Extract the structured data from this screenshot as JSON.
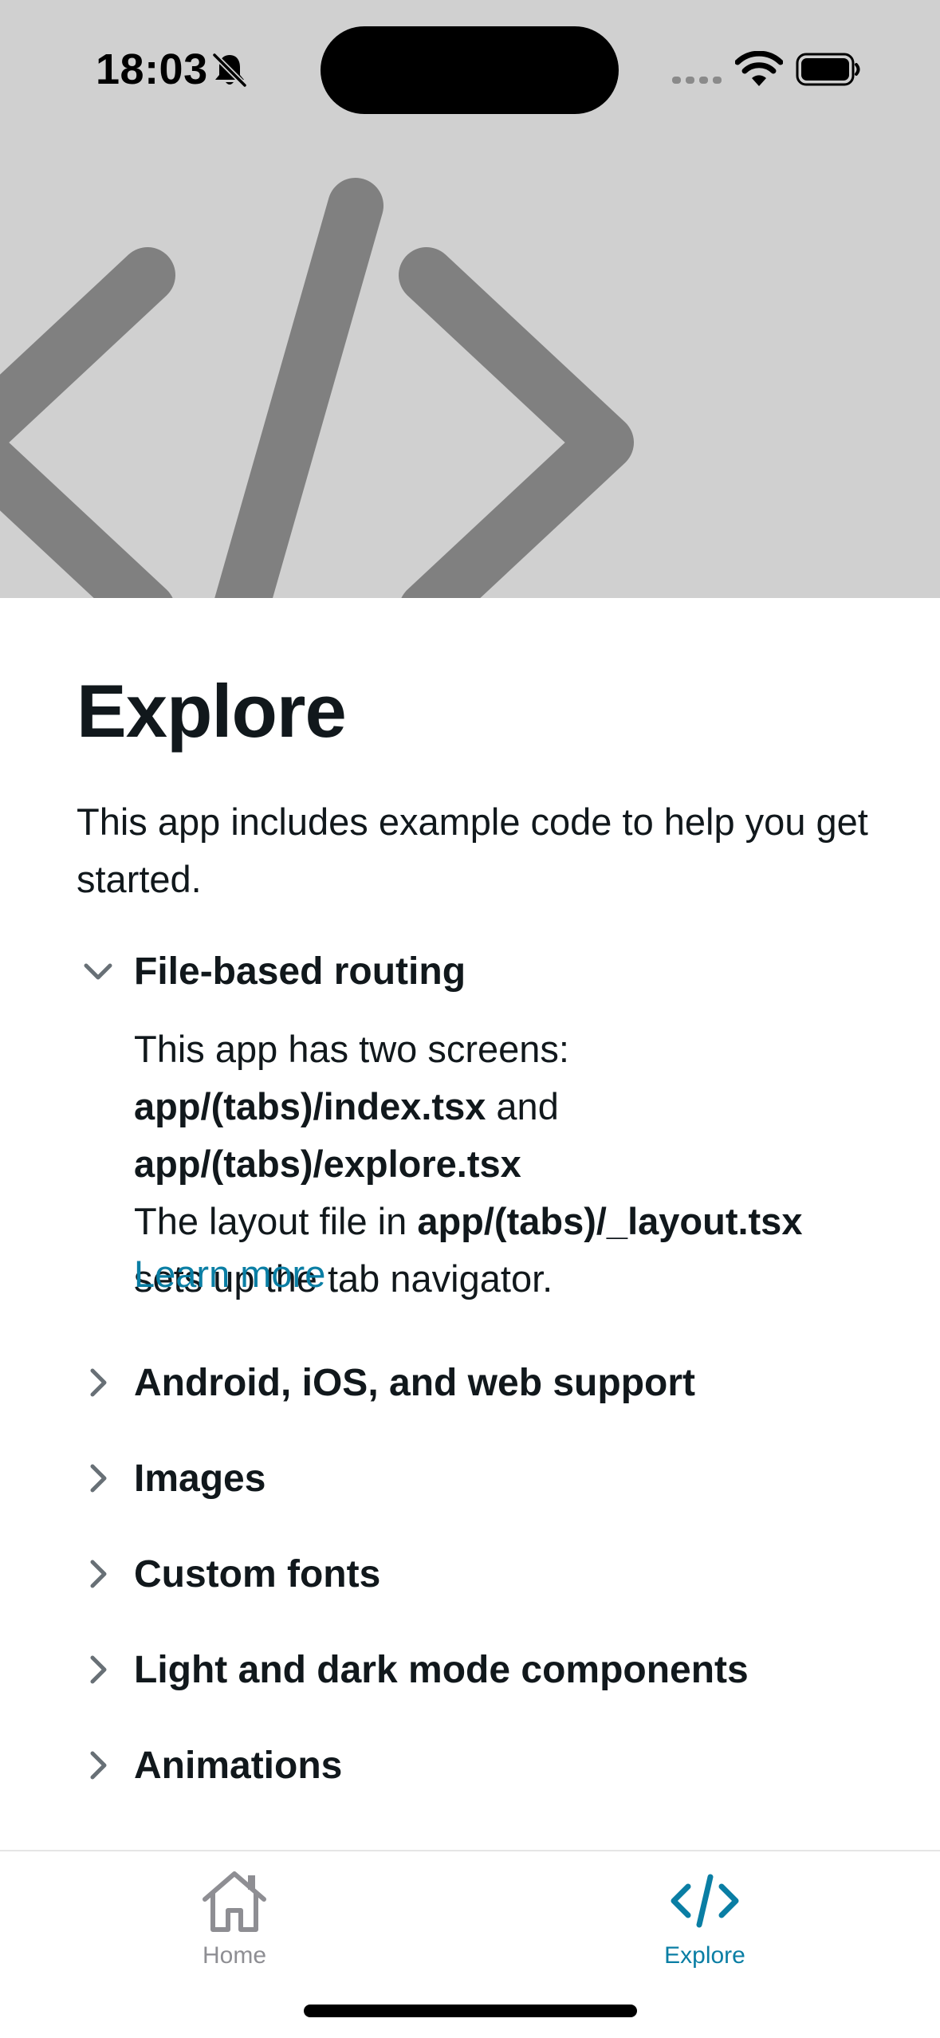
{
  "status_bar": {
    "time": "18:03",
    "icons": [
      "bell-slash-icon",
      "cellular-signal-icon",
      "wifi-icon",
      "battery-icon"
    ]
  },
  "hero": {
    "icon": "code-brackets-icon",
    "background": "#D0D0D0",
    "icon_color": "#808080"
  },
  "page": {
    "title": "Explore",
    "intro": "This app includes example code to help you get started."
  },
  "sections": [
    {
      "title": "File-based routing",
      "expanded": true,
      "body": {
        "t1": "This app has two screens: ",
        "b1": "app/(tabs)/index.tsx",
        "t2": " and ",
        "b2": "app/(tabs)/explore.tsx",
        "t3": "The layout file in ",
        "b3": "app/(tabs)/_layout.tsx",
        "t4": " sets up the tab navigator."
      },
      "link": "Learn more"
    },
    {
      "title": "Android, iOS, and web support",
      "expanded": false
    },
    {
      "title": "Images",
      "expanded": false
    },
    {
      "title": "Custom fonts",
      "expanded": false
    },
    {
      "title": "Light and dark mode components",
      "expanded": false
    },
    {
      "title": "Animations",
      "expanded": false
    }
  ],
  "tab_bar": {
    "tabs": [
      {
        "label": "Home",
        "icon": "house-icon",
        "active": false
      },
      {
        "label": "Explore",
        "icon": "code-brackets-icon",
        "active": true
      }
    ]
  },
  "colors": {
    "accent": "#0a7ea4",
    "text": "#11181C",
    "inactive_tab": "#8E8E93"
  }
}
